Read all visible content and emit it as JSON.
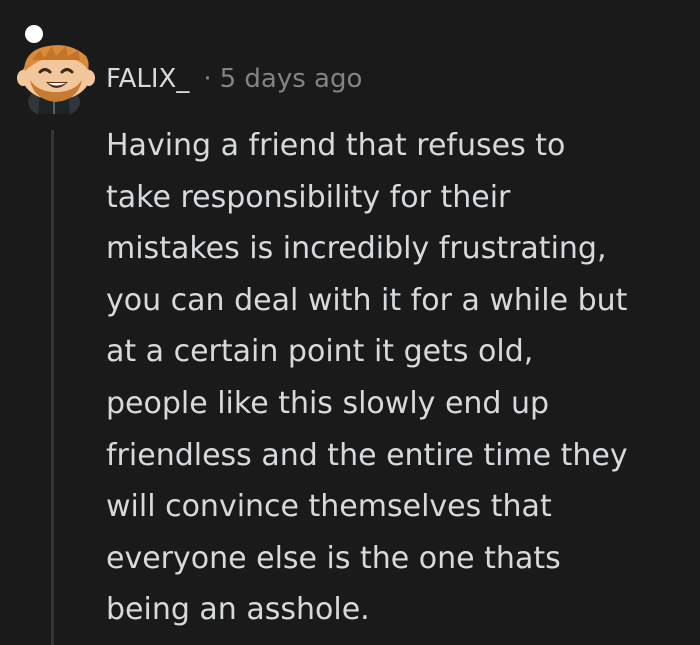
{
  "comment": {
    "author": "FALIX_",
    "separator": "·",
    "timestamp": "5 days ago",
    "avatar_icon": "snoo-avatar-icon",
    "body_lines": [
      "Having a friend that refuses to",
      "take responsibility for their",
      "mistakes is incredibly frustrating,",
      "you can deal with it for a while but",
      "at a certain point it gets old,",
      "people like this slowly end up",
      "friendless and the entire time they",
      "will convince themselves that",
      "everyone else is the one thats",
      "being an asshole."
    ]
  },
  "colors": {
    "background": "#1a1a1b",
    "text": "#d7dadc",
    "meta": "#818384",
    "thread_line": "#343536"
  }
}
